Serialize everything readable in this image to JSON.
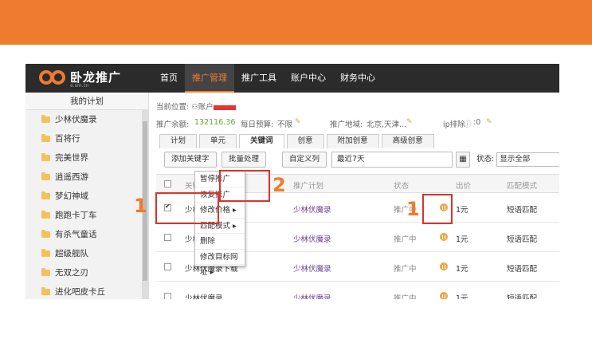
{
  "app": {
    "logo_name": "卧龙推广",
    "logo_sub": "e.sm.cn",
    "nav": [
      "首页",
      "推广管理",
      "推广工具",
      "账户中心",
      "财务中心"
    ]
  },
  "sidebar": {
    "header": "我的计划",
    "items": [
      "少林伏魔录",
      "百将行",
      "完美世界",
      "逍遥西游",
      "梦幻神域",
      "跑跑卡丁车",
      "有杀气童话",
      "超级舰队",
      "无双之刃",
      "进化吧皮卡丘"
    ]
  },
  "main": {
    "breadcrumb": "当前位置: ",
    "account_label": "账户",
    "balance_label": "推广余额: ",
    "balance_value": "132116.36",
    "budget_label": "每日预算: ",
    "budget_value": "不限",
    "region_label": "推广地域: ",
    "region_value": "北京,天津...",
    "ip_label": "ip排除",
    "ip_value": ":0",
    "tabs": [
      "计划",
      "单元",
      "关键词",
      "创意",
      "附加创意",
      "高级创意"
    ],
    "toolbar": {
      "add_keyword": "添加关键字",
      "batch": "批量处理",
      "custom_column": "自定义列",
      "date_range": "最近7天",
      "status_label": "状态:",
      "status_value": "显示全部"
    },
    "columns": {
      "keyword": "关键词",
      "plan": "推广计划",
      "status": "状态",
      "bid": "出价",
      "match": "匹配模式"
    },
    "rows": [
      {
        "keyword": "少林伏魔",
        "plan": "少林伏魔录",
        "status": "推广中",
        "bid": "1元",
        "match": "短语匹配",
        "checked": true
      },
      {
        "keyword": "少林伏魔录手",
        "plan": "少林伏魔录",
        "status": "推广中",
        "bid": "1元",
        "match": "短语匹配",
        "checked": false
      },
      {
        "keyword": "少林伏魔录下载",
        "plan": "少林伏魔录",
        "status": "推广中",
        "bid": "1元",
        "match": "短语匹配",
        "checked": false
      },
      {
        "keyword": "少林伏魔录",
        "plan": "少林伏魔录",
        "status": "推广中",
        "bid": "1元",
        "match": "短语匹配",
        "checked": false
      }
    ]
  },
  "menu": {
    "items": [
      "暂停推广",
      "恢复推广",
      "修改价格 ▸",
      "匹配模式 ▸",
      "删除",
      "修改目标网址 ▸"
    ]
  },
  "annotations": {
    "step1_left": "1",
    "step2": "2",
    "step1_right": "1"
  },
  "colors": {
    "accent": "#ee7b2e",
    "nav_bg": "#2b2b2b",
    "annotation": "#d9342b",
    "plan_link": "#6b3f9c"
  }
}
